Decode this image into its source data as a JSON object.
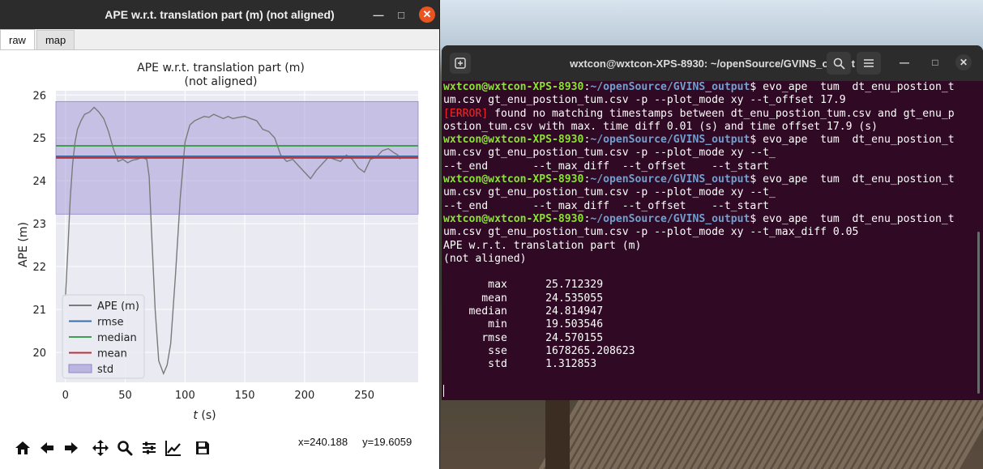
{
  "matplotlib_window": {
    "title": "APE w.r.t. translation part (m) (not aligned)",
    "controls": {
      "minimize": "—",
      "maximize": "□",
      "close": "✕"
    },
    "tabs": [
      {
        "label": "raw",
        "active": true
      },
      {
        "label": "map",
        "active": false
      }
    ],
    "toolbar": {
      "icons": [
        "home-icon",
        "back-arrow-icon",
        "forward-arrow-icon",
        "pan-move-icon",
        "zoom-icon",
        "subplot-config-icon",
        "axes-edit-icon",
        "save-icon"
      ],
      "coord_x": "x=240.188",
      "coord_y": "y=19.6059"
    }
  },
  "chart_data": {
    "type": "line",
    "title": "APE w.r.t. translation part (m)",
    "subtitle": "(not aligned)",
    "xlabel": "t (s)",
    "xlabel_t": "t",
    "xlabel_unit": " (s)",
    "ylabel": "APE (m)",
    "xlim": [
      -8,
      295
    ],
    "ylim": [
      19.3,
      26.1
    ],
    "xticks": [
      0,
      50,
      100,
      150,
      200,
      250
    ],
    "yticks": [
      20,
      21,
      22,
      23,
      24,
      25,
      26
    ],
    "grid": true,
    "legend_position": "lower-left",
    "colors": {
      "ape": "#7a7a7a",
      "rmse": "#3b6ea8",
      "median": "#3f9f51",
      "mean": "#b8333a",
      "std": "#a89ed8",
      "axes_bg": "#eaeaf2"
    },
    "series": [
      {
        "name": "APE (m)",
        "x": [
          0,
          2,
          4,
          6,
          8,
          10,
          13,
          16,
          20,
          24,
          28,
          32,
          36,
          40,
          44,
          48,
          52,
          56,
          60,
          64,
          68,
          70,
          72,
          75,
          78,
          82,
          85,
          88,
          92,
          96,
          100,
          104,
          108,
          112,
          116,
          120,
          124,
          128,
          132,
          136,
          140,
          145,
          150,
          155,
          160,
          165,
          170,
          175,
          180,
          185,
          190,
          195,
          200,
          205,
          210,
          215,
          220,
          225,
          230,
          235,
          240,
          245,
          250,
          255,
          260,
          265,
          270,
          275,
          278,
          280
        ],
        "y": [
          21.3,
          22.4,
          23.6,
          24.4,
          24.9,
          25.2,
          25.4,
          25.55,
          25.6,
          25.712,
          25.6,
          25.45,
          25.15,
          24.75,
          24.45,
          24.5,
          24.42,
          24.48,
          24.5,
          24.55,
          24.5,
          24.1,
          22.8,
          21.0,
          19.8,
          19.503,
          19.7,
          20.2,
          21.8,
          23.6,
          24.9,
          25.3,
          25.4,
          25.45,
          25.5,
          25.48,
          25.55,
          25.5,
          25.45,
          25.5,
          25.45,
          25.48,
          25.5,
          25.45,
          25.4,
          25.2,
          25.15,
          25.0,
          24.6,
          24.45,
          24.5,
          24.35,
          24.2,
          24.05,
          24.25,
          24.4,
          24.55,
          24.5,
          24.45,
          24.6,
          24.5,
          24.3,
          24.2,
          24.5,
          24.55,
          24.7,
          24.75,
          24.65,
          24.6,
          24.5
        ]
      },
      {
        "name": "rmse",
        "value": 24.570155
      },
      {
        "name": "median",
        "value": 24.814947
      },
      {
        "name": "mean",
        "value": 24.535055
      },
      {
        "name": "std",
        "band": [
          23.222202,
          25.847908
        ]
      }
    ]
  },
  "terminal": {
    "title": "wxtcon@wxtcon-XPS-8930: ~/openSource/GVINS_output",
    "icons": [
      "new-tab-icon",
      "search-icon",
      "hamburger-menu-icon"
    ],
    "controls": {
      "minimize": "—",
      "maximize": "□",
      "close": "✕"
    },
    "lines": [
      {
        "user": "wxtcon@wxtcon-XPS-8930",
        "path": "~/openSource/GVINS_output",
        "text": "$ evo_ape  tum  dt_enu_postion_t"
      },
      {
        "text": "um.csv gt_enu_postion_tum.csv -p --plot_mode xy --t_offset 17.9"
      },
      {
        "err": "[ERROR]",
        "text": " found no matching timestamps between dt_enu_postion_tum.csv and gt_enu_p"
      },
      {
        "text": "ostion_tum.csv with max. time diff 0.01 (s) and time offset 17.9 (s)"
      },
      {
        "user": "wxtcon@wxtcon-XPS-8930",
        "path": "~/openSource/GVINS_output",
        "text": "$ evo_ape  tum  dt_enu_postion_t"
      },
      {
        "text": "um.csv gt_enu_postion_tum.csv -p --plot_mode xy --t_"
      },
      {
        "text": "--t_end       --t_max_diff  --t_offset    --t_start"
      },
      {
        "user": "wxtcon@wxtcon-XPS-8930",
        "path": "~/openSource/GVINS_output",
        "text": "$ evo_ape  tum  dt_enu_postion_t"
      },
      {
        "text": "um.csv gt_enu_postion_tum.csv -p --plot_mode xy --t_"
      },
      {
        "text": "--t_end       --t_max_diff  --t_offset    --t_start"
      },
      {
        "user": "wxtcon@wxtcon-XPS-8930",
        "path": "~/openSource/GVINS_output",
        "text": "$ evo_ape  tum  dt_enu_postion_t"
      },
      {
        "text": "um.csv gt_enu_postion_tum.csv -p --plot_mode xy --t_max_diff 0.05"
      },
      {
        "text": "APE w.r.t. translation part (m)"
      },
      {
        "text": "(not aligned)"
      },
      {
        "text": ""
      },
      {
        "text": "       max      25.712329"
      },
      {
        "text": "      mean      24.535055"
      },
      {
        "text": "    median      24.814947"
      },
      {
        "text": "       min      19.503546"
      },
      {
        "text": "      rmse      24.570155"
      },
      {
        "text": "       sse      1678265.208623"
      },
      {
        "text": "       std      1.312853"
      },
      {
        "text": ""
      },
      {
        "text": "",
        "cursor": true
      }
    ]
  }
}
